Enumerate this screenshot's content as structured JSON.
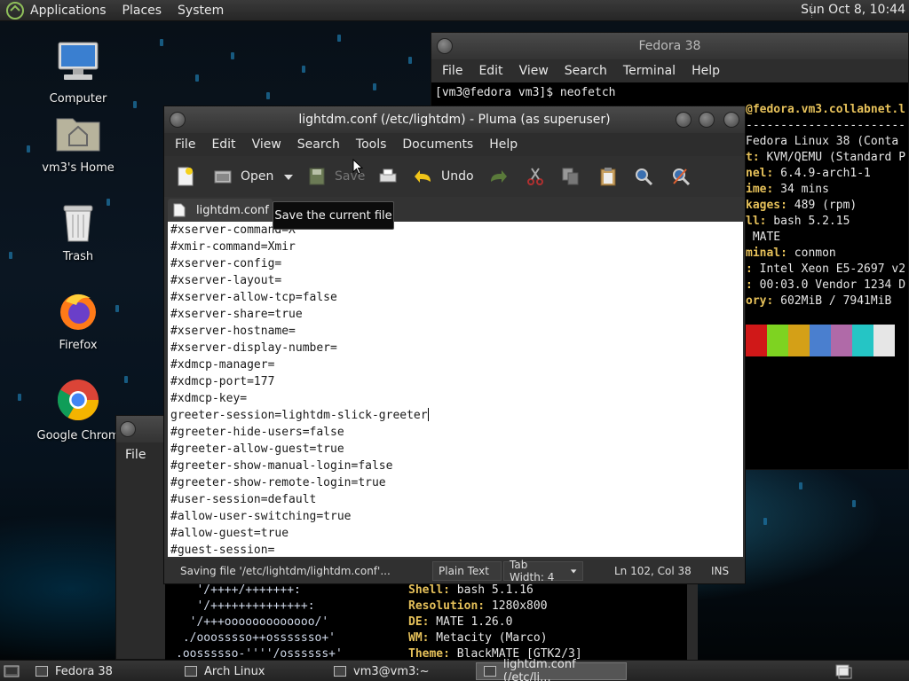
{
  "top_panel": {
    "menus": [
      "Applications",
      "Places",
      "System"
    ],
    "clock": "Sun Oct  8, 10:44"
  },
  "desktop_icons": [
    {
      "label": "Computer",
      "icon": "computer-icon"
    },
    {
      "label": "vm3's Home",
      "icon": "home-folder-icon"
    },
    {
      "label": "Trash",
      "icon": "trash-icon"
    },
    {
      "label": "Firefox",
      "icon": "firefox-icon"
    },
    {
      "label": "Google Chrom",
      "icon": "chrome-icon"
    }
  ],
  "terminal": {
    "title": "Fedora 38",
    "menus": [
      "File",
      "Edit",
      "View",
      "Search",
      "Terminal",
      "Help"
    ],
    "prompt_line": "[vm3@fedora vm3]$ neofetch",
    "info": [
      {
        "key": "",
        "val": "@fedora.vm3.collabnet.l"
      },
      {
        "key": "",
        "val": "-----------------------"
      },
      {
        "key": "",
        "val": "Fedora Linux 38 (Conta"
      },
      {
        "key": "t:",
        "val": " KVM/QEMU (Standard P"
      },
      {
        "key": "nel:",
        "val": " 6.4.9-arch1-1"
      },
      {
        "key": "ime:",
        "val": " 34 mins"
      },
      {
        "key": "kages:",
        "val": " 489 (rpm)"
      },
      {
        "key": "ll:",
        "val": " bash 5.2.15"
      },
      {
        "key": "",
        "val": " MATE"
      },
      {
        "key": "minal:",
        "val": " conmon"
      },
      {
        "key": ":",
        "val": " Intel Xeon E5-2697 v2"
      },
      {
        "key": ":",
        "val": " 00:03.0 Vendor 1234 D"
      },
      {
        "key": "ory:",
        "val": " 602MiB / 7941MiB"
      }
    ],
    "swatch_colors": [
      "#d01818",
      "#7ed321",
      "#d4a017",
      "#4a7fcf",
      "#b06aa8",
      "#25c5c5",
      "#e6e6e6"
    ]
  },
  "partial_window": {
    "menu_label": "File"
  },
  "lower_terminal": {
    "ascii": [
      "   '/++++/+++++++:",
      "   '/++++++++++++++:",
      "  '/+++ooooooooooooo/'",
      " ./ooosssso++osssssso+'",
      ".oossssso-''''/ossssss+'"
    ],
    "info": [
      {
        "key": "Shell:",
        "val": " bash 5.1.16"
      },
      {
        "key": "Resolution:",
        "val": " 1280x800"
      },
      {
        "key": "DE:",
        "val": " MATE 1.26.0"
      },
      {
        "key": "WM:",
        "val": " Metacity (Marco)"
      },
      {
        "key": "Theme:",
        "val": " BlackMATE [GTK2/3]"
      }
    ]
  },
  "pluma": {
    "title": "lightdm.conf (/etc/lightdm) - Pluma (as superuser)",
    "menus": [
      "File",
      "Edit",
      "View",
      "Search",
      "Tools",
      "Documents",
      "Help"
    ],
    "toolbar": {
      "open_label": "Open",
      "save_label": "Save",
      "undo_label": "Undo"
    },
    "tab_label": "lightdm.conf",
    "tooltip": "Save the current file",
    "lines": [
      "#xserver-command=X",
      "#xmir-command=Xmir",
      "#xserver-config=",
      "#xserver-layout=",
      "#xserver-allow-tcp=false",
      "#xserver-share=true",
      "#xserver-hostname=",
      "#xserver-display-number=",
      "#xdmcp-manager=",
      "#xdmcp-port=177",
      "#xdmcp-key=",
      "greeter-session=lightdm-slick-greeter",
      "#greeter-hide-users=false",
      "#greeter-allow-guest=true",
      "#greeter-show-manual-login=false",
      "#greeter-show-remote-login=true",
      "#user-session=default",
      "#allow-user-switching=true",
      "#allow-guest=true",
      "#guest-session="
    ],
    "status": {
      "message": "Saving file '/etc/lightdm/lightdm.conf'...",
      "language": "Plain Text",
      "tab_width": "Tab Width:  4",
      "position": "Ln 102, Col 38",
      "mode": "INS"
    }
  },
  "taskbar": {
    "tasks": [
      {
        "label": "Fedora 38",
        "active": false
      },
      {
        "label": "Arch Linux",
        "active": false
      },
      {
        "label": "vm3@vm3:~",
        "active": false
      },
      {
        "label": "lightdm.conf (/etc/li...",
        "active": true
      }
    ]
  }
}
